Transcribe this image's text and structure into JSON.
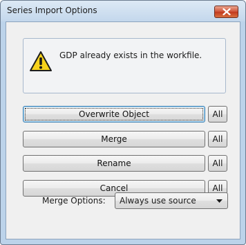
{
  "window": {
    "title": "Series Import Options"
  },
  "message": {
    "text": "GDP already exists in the workfile.",
    "icon": "warning-icon"
  },
  "actions": [
    {
      "label": "Overwrite Object",
      "all_label": "All"
    },
    {
      "label": "Merge",
      "all_label": "All"
    },
    {
      "label": "Rename",
      "all_label": "All"
    },
    {
      "label": "Cancel",
      "all_label": "All"
    }
  ],
  "merge_options": {
    "label": "Merge Options:",
    "selected": "Always use source"
  },
  "colors": {
    "close_button": "#c74a2c",
    "titlebar": "#c3d7ec",
    "dialog_bg": "#f0f0f0"
  }
}
